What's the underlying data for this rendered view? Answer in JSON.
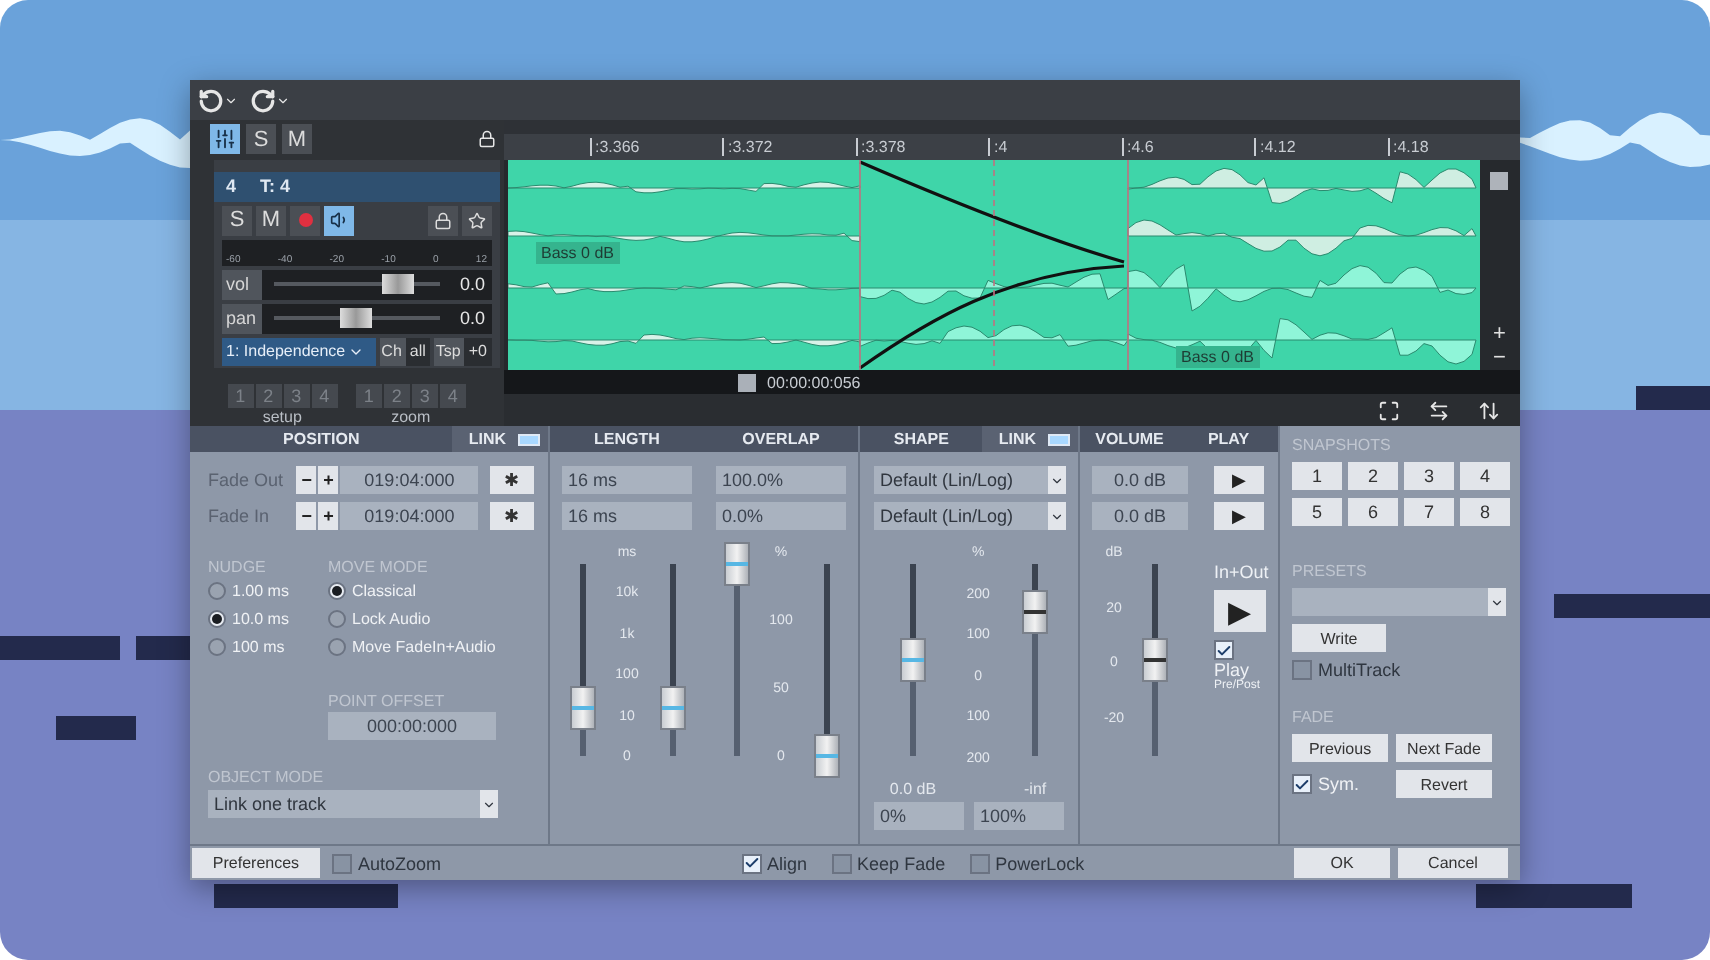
{
  "mixer_buttons": [
    {
      "label": "S"
    },
    {
      "label": "M"
    }
  ],
  "track": {
    "number": "4",
    "name": "T: 4",
    "solo": "S",
    "mute": "M",
    "record_armed": true,
    "monitor_on": true,
    "meter_ticks": [
      "-60",
      "-40",
      "-20",
      "-10",
      "0",
      "12"
    ],
    "vol": {
      "label": "vol",
      "level": 0.75,
      "reading": "0.0"
    },
    "pan": {
      "label": "pan",
      "level": 0.5,
      "reading": "0.0"
    },
    "input": "1: Independence",
    "ch_label": "Ch",
    "ch_value": "all",
    "tsp_label": "Tsp",
    "tsp_value": "+0"
  },
  "setup": {
    "label": "setup",
    "buttons": [
      "1",
      "2",
      "3",
      "4"
    ]
  },
  "zoom": {
    "label": "zoom",
    "buttons": [
      "1",
      "2",
      "3",
      "4"
    ]
  },
  "ruler": [
    ":3.366",
    ":3.372",
    ":3.378",
    ":4",
    ":4.6",
    ":4.12",
    ":4.18"
  ],
  "clip_labels": [
    {
      "name": "Bass",
      "gain": "0 dB"
    },
    {
      "name": "Bass",
      "gain": "0 dB"
    }
  ],
  "timecode": "00:00:00:056",
  "scroll_buttons": [
    "+",
    "−"
  ],
  "position": {
    "title": "POSITION",
    "link_label": "LINK",
    "link_on": true,
    "rows": [
      {
        "label": "Fade Out",
        "minus": "−",
        "plus": "+",
        "value": "019:04:000",
        "action": "✱"
      },
      {
        "label": "Fade In",
        "minus": "−",
        "plus": "+",
        "value": "019:04:000",
        "action": "✱"
      }
    ],
    "nudge": {
      "title": "NUDGE",
      "options": [
        {
          "label": "1.00 ms",
          "selected": false
        },
        {
          "label": "10.0 ms",
          "selected": true
        },
        {
          "label": "100 ms",
          "selected": false
        }
      ]
    },
    "move_mode": {
      "title": "MOVE MODE",
      "options": [
        {
          "label": "Classical",
          "selected": true
        },
        {
          "label": "Lock Audio",
          "selected": false
        },
        {
          "label": "Move FadeIn+Audio",
          "selected": false
        }
      ]
    },
    "point_offset": {
      "title": "POINT OFFSET",
      "value": "000:00:000"
    },
    "object_mode": {
      "title": "OBJECT MODE",
      "value": "Link one track"
    }
  },
  "length": {
    "title": "LENGTH",
    "values": [
      "16 ms",
      "16 ms"
    ],
    "unit": "ms",
    "scale": [
      "10k",
      "1k",
      "100",
      "10",
      "0"
    ],
    "faders": [
      {
        "level": 0.25
      },
      {
        "level": 0.25
      }
    ]
  },
  "overlap": {
    "title": "OVERLAP",
    "values": [
      "100.0%",
      "0.0%"
    ],
    "unit": "%",
    "scale": [
      "100",
      "50",
      "0"
    ],
    "faders": [
      {
        "level": 1.0
      },
      {
        "level": 0.0
      }
    ]
  },
  "shape": {
    "title": "SHAPE",
    "link_label": "LINK",
    "link_on": true,
    "values": [
      "Default (Lin/Log)",
      "Default (Lin/Log)"
    ],
    "unit": "%",
    "scale": [
      "200",
      "100",
      "0",
      "100",
      "200"
    ],
    "faders": [
      {
        "level": 0.5,
        "caption": "0.0 dB",
        "field": "0%"
      },
      {
        "level": 0.75,
        "caption": "-inf",
        "field": "100%"
      }
    ]
  },
  "volume": {
    "title": "VOLUME",
    "values": [
      "0.0 dB",
      "0.0 dB"
    ],
    "unit": "dB",
    "scale": [
      "20",
      "0",
      "-20"
    ],
    "fader": {
      "level": 0.5
    }
  },
  "play": {
    "title": "PLAY",
    "buttons": [
      "▶",
      "▶"
    ],
    "in_out_label": "In+Out",
    "in_out_button": "▶",
    "pre_post": {
      "checked": true,
      "label": "Play",
      "sublabel": "Pre/Post"
    }
  },
  "snapshots": {
    "title": "SNAPSHOTS",
    "buttons": [
      "1",
      "2",
      "3",
      "4",
      "5",
      "6",
      "7",
      "8"
    ]
  },
  "presets": {
    "title": "PRESETS",
    "write": "Write",
    "multitrack": {
      "label": "MultiTrack",
      "checked": false
    }
  },
  "fade": {
    "title": "FADE",
    "previous": "Previous",
    "next": "Next Fade",
    "sym": {
      "label": "Sym.",
      "checked": true
    },
    "revert": "Revert"
  },
  "footer": {
    "preferences": "Preferences",
    "options": [
      {
        "label": "AutoZoom",
        "checked": false
      },
      {
        "label": "Align",
        "checked": true
      },
      {
        "label": "Keep Fade",
        "checked": false
      },
      {
        "label": "PowerLock",
        "checked": false
      }
    ],
    "ok": "OK",
    "cancel": "Cancel"
  }
}
